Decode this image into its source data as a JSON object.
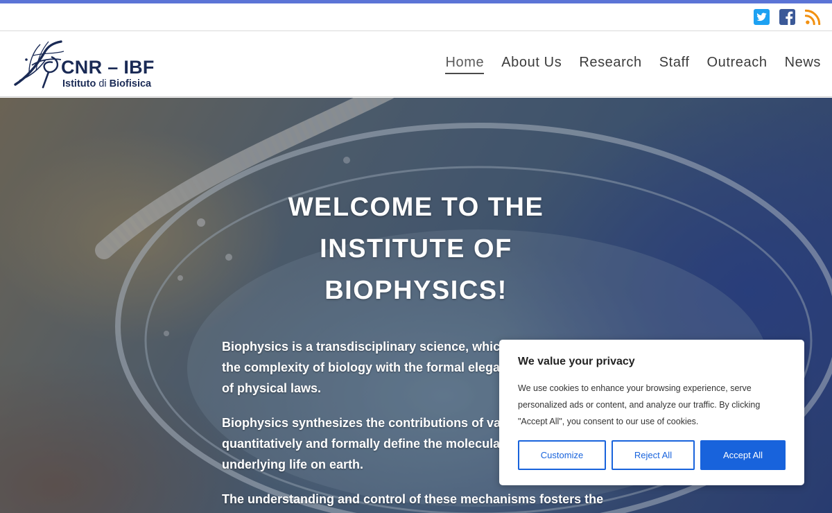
{
  "colors": {
    "accent_stripe": "#5b74d6",
    "brand_navy": "#1a2a55",
    "twitter": "#1da1f2",
    "facebook": "#3b5998",
    "rss": "#f29111",
    "cookie_primary": "#1863dc"
  },
  "social": {
    "icons": [
      "twitter-icon",
      "facebook-icon",
      "rss-icon"
    ]
  },
  "header": {
    "logo": {
      "title": "CNR – IBF",
      "subtitle_bold_1": "Istituto",
      "subtitle_mid": " di ",
      "subtitle_bold_2": "Biofisica"
    },
    "nav": [
      {
        "label": "Home",
        "active": true
      },
      {
        "label": "About Us"
      },
      {
        "label": "Research"
      },
      {
        "label": "Staff"
      },
      {
        "label": "Outreach"
      },
      {
        "label": "News"
      }
    ]
  },
  "hero": {
    "title_line1": "WELCOME TO THE",
    "title_line2": "INSTITUTE OF",
    "title_line3": "BIOPHYSICS!",
    "paragraphs": [
      "Biophysics is a transdisciplinary science, which i",
      "the complexity of biology with the formal elegan",
      "of physical laws.",
      "Biophysics synthesizes the contributions of vario",
      "quantitatively and formally define the molecular",
      "underlying life on earth.",
      "The understanding and control of these mechanisms fosters the"
    ]
  },
  "cookie": {
    "title": "We value your privacy",
    "body": "We use cookies to enhance your browsing experience, serve personalized ads or content, and analyze our traffic. By clicking \"Accept All\", you consent to our use of cookies.",
    "customize_label": "Customize",
    "reject_label": "Reject All",
    "accept_label": "Accept All"
  }
}
